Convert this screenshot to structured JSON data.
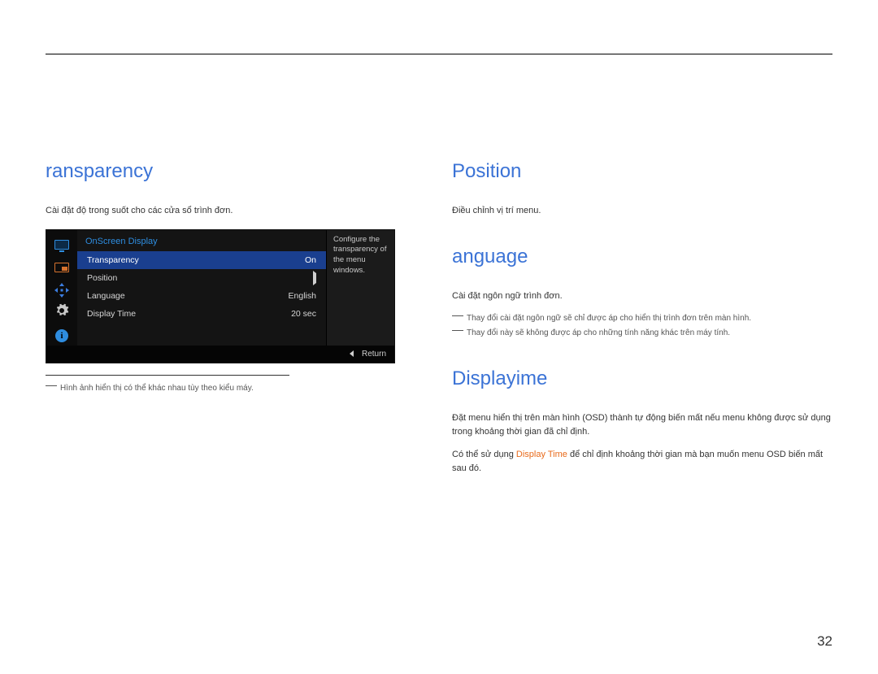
{
  "page_number": "32",
  "left": {
    "heading": "ransparency",
    "desc": "Cài đặt độ trong suốt cho các cửa sổ trình đơn.",
    "footnote": "Hình ảnh hiển thị có thể khác nhau tùy theo kiểu máy."
  },
  "osd": {
    "title": "OnScreen Display",
    "rows": [
      {
        "label": "Transparency",
        "value": "On",
        "selected": true,
        "arrow": false
      },
      {
        "label": "Position",
        "value": "",
        "selected": false,
        "arrow": true
      },
      {
        "label": "Language",
        "value": "English",
        "selected": false,
        "arrow": false
      },
      {
        "label": "Display Time",
        "value": "20 sec",
        "selected": false,
        "arrow": false
      }
    ],
    "desc": "Configure the transparency of the menu windows.",
    "return": "Return"
  },
  "right": {
    "position": {
      "heading": "Position",
      "desc": "Điều chỉnh vị trí menu."
    },
    "language": {
      "heading": "anguage",
      "desc": "Cài đặt ngôn ngữ trình đơn.",
      "note1": "Thay đổi cài đặt ngôn ngữ sẽ chỉ được áp cho hiển thị trình đơn trên màn hình.",
      "note2": "Thay đổi này sẽ không được áp cho những tính năng khác trên máy tính."
    },
    "displaytime": {
      "heading": "Displayime",
      "desc1": "Đặt menu hiển thị trên màn hình (OSD) thành tự động biến mất nếu menu không được sử dụng trong khoảng thời gian đã chỉ định.",
      "desc2_pre": "Có thể sử dụng ",
      "desc2_hl": "Display Time",
      "desc2_post": " để chỉ định khoảng thời gian mà bạn muốn menu OSD biến mất sau đó."
    }
  }
}
